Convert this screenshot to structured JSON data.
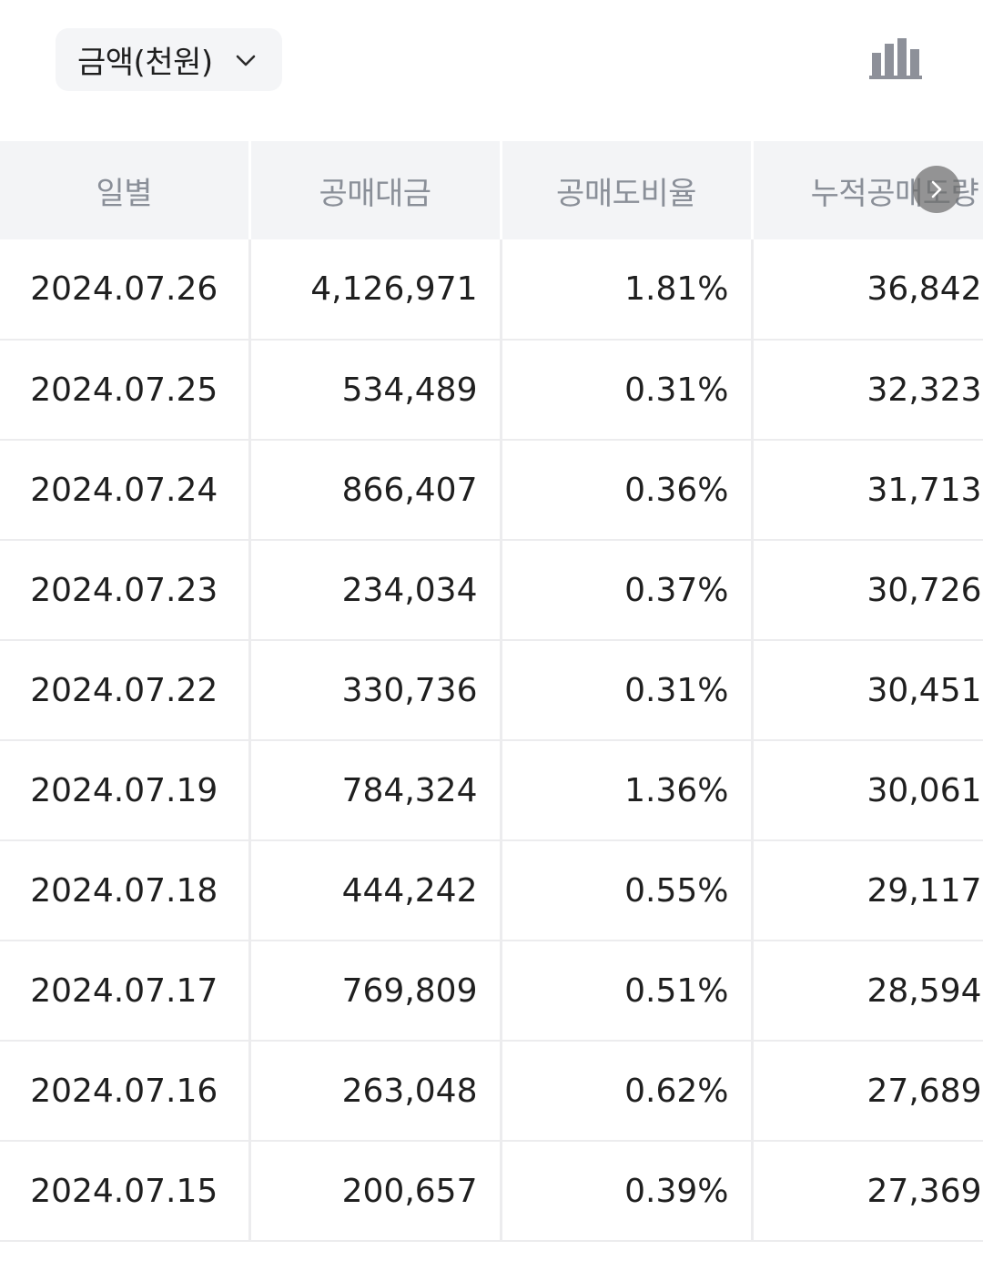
{
  "toolbar": {
    "unit_select": {
      "selected": "금액(천원)",
      "icon": "chevron-down-icon"
    },
    "chart_toggle": {
      "icon": "bar-chart-icon"
    }
  },
  "table": {
    "columns": [
      "일별",
      "공매대금",
      "공매도비율",
      "누적공매도량"
    ],
    "scroll_icon": "chevron-right-icon",
    "rows": [
      {
        "date": "2024.07.26",
        "amount": "4,126,971",
        "ratio": "1.81%",
        "cumulative": "36,842"
      },
      {
        "date": "2024.07.25",
        "amount": "534,489",
        "ratio": "0.31%",
        "cumulative": "32,323"
      },
      {
        "date": "2024.07.24",
        "amount": "866,407",
        "ratio": "0.36%",
        "cumulative": "31,713"
      },
      {
        "date": "2024.07.23",
        "amount": "234,034",
        "ratio": "0.37%",
        "cumulative": "30,726"
      },
      {
        "date": "2024.07.22",
        "amount": "330,736",
        "ratio": "0.31%",
        "cumulative": "30,451"
      },
      {
        "date": "2024.07.19",
        "amount": "784,324",
        "ratio": "1.36%",
        "cumulative": "30,061"
      },
      {
        "date": "2024.07.18",
        "amount": "444,242",
        "ratio": "0.55%",
        "cumulative": "29,117"
      },
      {
        "date": "2024.07.17",
        "amount": "769,809",
        "ratio": "0.51%",
        "cumulative": "28,594"
      },
      {
        "date": "2024.07.16",
        "amount": "263,048",
        "ratio": "0.62%",
        "cumulative": "27,689"
      },
      {
        "date": "2024.07.15",
        "amount": "200,657",
        "ratio": "0.39%",
        "cumulative": "27,369"
      }
    ]
  }
}
